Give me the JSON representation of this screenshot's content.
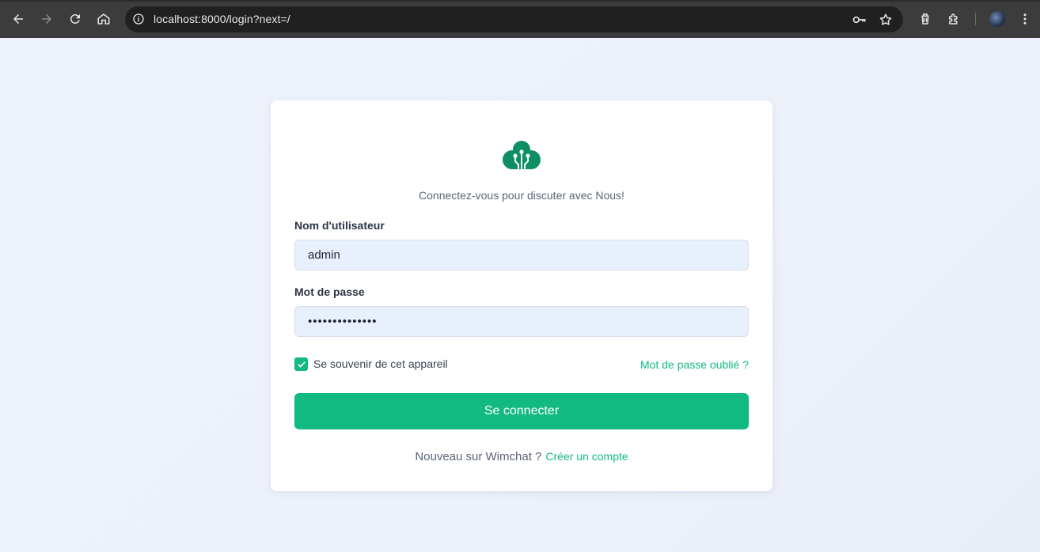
{
  "browser": {
    "url": "localhost:8000/login?next=/",
    "icons": [
      "back-icon",
      "forward-icon",
      "reload-icon",
      "home-icon",
      "site-info-icon",
      "password-key-icon",
      "bookmark-star-icon",
      "delete-icon",
      "extensions-icon",
      "profile-avatar",
      "menu-icon"
    ]
  },
  "login": {
    "subtitle": "Connectez-vous pour discuter avec Nous!",
    "username_label": "Nom d'utilisateur",
    "username_value": "admin",
    "password_label": "Mot de passe",
    "password_value": "••••••••••••••",
    "remember_label": "Se souvenir de cet appareil",
    "remember_checked": true,
    "forgot_link": "Mot de passe oublié ?",
    "submit_label": "Se connecter",
    "signup_prompt": "Nouveau sur Wimchat ?",
    "signup_link": "Créer un compte"
  },
  "colors": {
    "accent": "#12b981",
    "logo": "#0e8f62",
    "input_bg": "#e8f0fe",
    "page_bg": "#eef2fa",
    "chrome_bg": "#3c3c3c"
  }
}
